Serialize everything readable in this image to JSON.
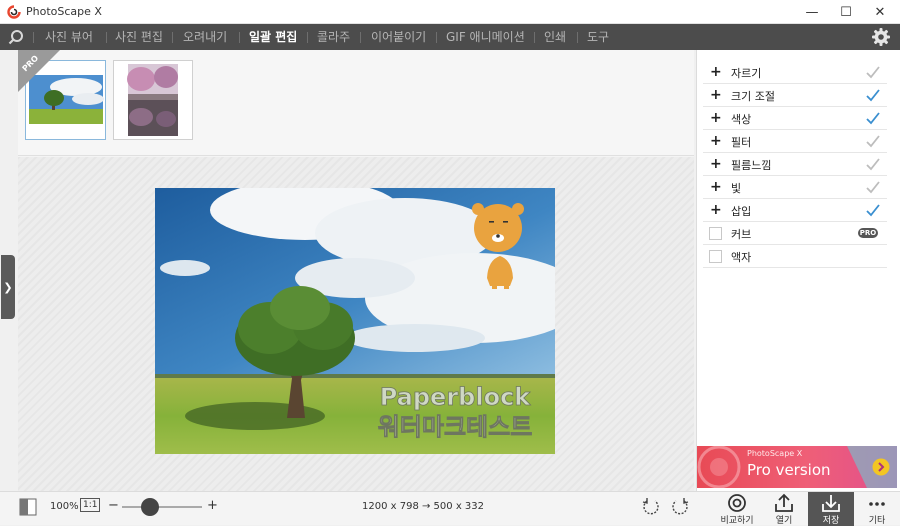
{
  "window": {
    "title": "PhotoScape X",
    "minimize": "—",
    "maximize": "☐",
    "close": "✕"
  },
  "menu": {
    "items": [
      {
        "label": "사진 뷰어"
      },
      {
        "label": "사진 편집"
      },
      {
        "label": "오려내기"
      },
      {
        "label": "일괄 편집",
        "active": true
      },
      {
        "label": "콜라주"
      },
      {
        "label": "이어붙이기"
      },
      {
        "label": "GIF 애니메이션"
      },
      {
        "label": "인쇄"
      },
      {
        "label": "도구"
      }
    ]
  },
  "thumbnails": {
    "pro_badge": "PRO"
  },
  "canvas": {
    "watermark_line1": "Paperblock",
    "watermark_line2": "워터마크테스트"
  },
  "tools": [
    {
      "label": "자르기",
      "state": "plus",
      "checked": false
    },
    {
      "label": "크기 조절",
      "state": "plus",
      "checked": true
    },
    {
      "label": "색상",
      "state": "plus",
      "checked": true
    },
    {
      "label": "필터",
      "state": "plus",
      "checked": false
    },
    {
      "label": "필름느낌",
      "state": "plus",
      "checked": false
    },
    {
      "label": "빛",
      "state": "plus",
      "checked": false
    },
    {
      "label": "삽입",
      "state": "plus",
      "checked": true
    },
    {
      "label": "커브",
      "state": "box",
      "pro": "PRO"
    },
    {
      "label": "액자",
      "state": "box"
    }
  ],
  "ad": {
    "brand": "PhotoScape X",
    "text": "Pro version"
  },
  "bottom": {
    "zoom": "100%",
    "one_to_one": "1:1",
    "zoom_minus": "−",
    "zoom_plus": "+",
    "zoom_level": 0.35,
    "dimensions": "1200 x 798 → 500 x 332",
    "compare_label": "비교하기",
    "open_label": "열기",
    "save_label": "저장",
    "more_label": "기타"
  },
  "colors": {
    "check_active": "#3a8fd0",
    "check_inactive": "#bdbdbd",
    "menu_bg": "#4c4c4c",
    "accent_logo": "#e8462f"
  }
}
